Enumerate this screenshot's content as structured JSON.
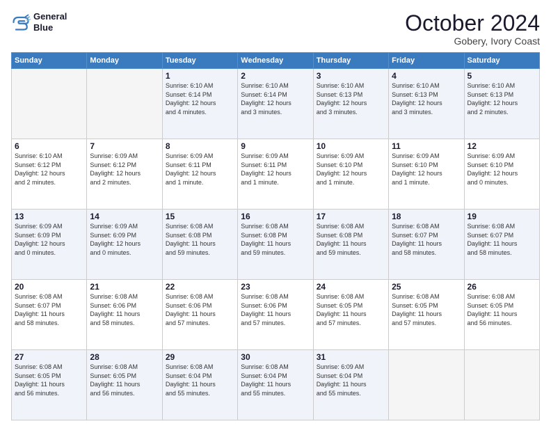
{
  "logo": {
    "line1": "General",
    "line2": "Blue"
  },
  "header": {
    "month": "October 2024",
    "location": "Gobery, Ivory Coast"
  },
  "weekdays": [
    "Sunday",
    "Monday",
    "Tuesday",
    "Wednesday",
    "Thursday",
    "Friday",
    "Saturday"
  ],
  "weeks": [
    [
      {
        "day": null,
        "info": null
      },
      {
        "day": null,
        "info": null
      },
      {
        "day": "1",
        "info": "Sunrise: 6:10 AM\nSunset: 6:14 PM\nDaylight: 12 hours\nand 4 minutes."
      },
      {
        "day": "2",
        "info": "Sunrise: 6:10 AM\nSunset: 6:14 PM\nDaylight: 12 hours\nand 3 minutes."
      },
      {
        "day": "3",
        "info": "Sunrise: 6:10 AM\nSunset: 6:13 PM\nDaylight: 12 hours\nand 3 minutes."
      },
      {
        "day": "4",
        "info": "Sunrise: 6:10 AM\nSunset: 6:13 PM\nDaylight: 12 hours\nand 3 minutes."
      },
      {
        "day": "5",
        "info": "Sunrise: 6:10 AM\nSunset: 6:13 PM\nDaylight: 12 hours\nand 2 minutes."
      }
    ],
    [
      {
        "day": "6",
        "info": "Sunrise: 6:10 AM\nSunset: 6:12 PM\nDaylight: 12 hours\nand 2 minutes."
      },
      {
        "day": "7",
        "info": "Sunrise: 6:09 AM\nSunset: 6:12 PM\nDaylight: 12 hours\nand 2 minutes."
      },
      {
        "day": "8",
        "info": "Sunrise: 6:09 AM\nSunset: 6:11 PM\nDaylight: 12 hours\nand 1 minute."
      },
      {
        "day": "9",
        "info": "Sunrise: 6:09 AM\nSunset: 6:11 PM\nDaylight: 12 hours\nand 1 minute."
      },
      {
        "day": "10",
        "info": "Sunrise: 6:09 AM\nSunset: 6:10 PM\nDaylight: 12 hours\nand 1 minute."
      },
      {
        "day": "11",
        "info": "Sunrise: 6:09 AM\nSunset: 6:10 PM\nDaylight: 12 hours\nand 1 minute."
      },
      {
        "day": "12",
        "info": "Sunrise: 6:09 AM\nSunset: 6:10 PM\nDaylight: 12 hours\nand 0 minutes."
      }
    ],
    [
      {
        "day": "13",
        "info": "Sunrise: 6:09 AM\nSunset: 6:09 PM\nDaylight: 12 hours\nand 0 minutes."
      },
      {
        "day": "14",
        "info": "Sunrise: 6:09 AM\nSunset: 6:09 PM\nDaylight: 12 hours\nand 0 minutes."
      },
      {
        "day": "15",
        "info": "Sunrise: 6:08 AM\nSunset: 6:08 PM\nDaylight: 11 hours\nand 59 minutes."
      },
      {
        "day": "16",
        "info": "Sunrise: 6:08 AM\nSunset: 6:08 PM\nDaylight: 11 hours\nand 59 minutes."
      },
      {
        "day": "17",
        "info": "Sunrise: 6:08 AM\nSunset: 6:08 PM\nDaylight: 11 hours\nand 59 minutes."
      },
      {
        "day": "18",
        "info": "Sunrise: 6:08 AM\nSunset: 6:07 PM\nDaylight: 11 hours\nand 58 minutes."
      },
      {
        "day": "19",
        "info": "Sunrise: 6:08 AM\nSunset: 6:07 PM\nDaylight: 11 hours\nand 58 minutes."
      }
    ],
    [
      {
        "day": "20",
        "info": "Sunrise: 6:08 AM\nSunset: 6:07 PM\nDaylight: 11 hours\nand 58 minutes."
      },
      {
        "day": "21",
        "info": "Sunrise: 6:08 AM\nSunset: 6:06 PM\nDaylight: 11 hours\nand 58 minutes."
      },
      {
        "day": "22",
        "info": "Sunrise: 6:08 AM\nSunset: 6:06 PM\nDaylight: 11 hours\nand 57 minutes."
      },
      {
        "day": "23",
        "info": "Sunrise: 6:08 AM\nSunset: 6:06 PM\nDaylight: 11 hours\nand 57 minutes."
      },
      {
        "day": "24",
        "info": "Sunrise: 6:08 AM\nSunset: 6:05 PM\nDaylight: 11 hours\nand 57 minutes."
      },
      {
        "day": "25",
        "info": "Sunrise: 6:08 AM\nSunset: 6:05 PM\nDaylight: 11 hours\nand 57 minutes."
      },
      {
        "day": "26",
        "info": "Sunrise: 6:08 AM\nSunset: 6:05 PM\nDaylight: 11 hours\nand 56 minutes."
      }
    ],
    [
      {
        "day": "27",
        "info": "Sunrise: 6:08 AM\nSunset: 6:05 PM\nDaylight: 11 hours\nand 56 minutes."
      },
      {
        "day": "28",
        "info": "Sunrise: 6:08 AM\nSunset: 6:05 PM\nDaylight: 11 hours\nand 56 minutes."
      },
      {
        "day": "29",
        "info": "Sunrise: 6:08 AM\nSunset: 6:04 PM\nDaylight: 11 hours\nand 55 minutes."
      },
      {
        "day": "30",
        "info": "Sunrise: 6:08 AM\nSunset: 6:04 PM\nDaylight: 11 hours\nand 55 minutes."
      },
      {
        "day": "31",
        "info": "Sunrise: 6:09 AM\nSunset: 6:04 PM\nDaylight: 11 hours\nand 55 minutes."
      },
      {
        "day": null,
        "info": null
      },
      {
        "day": null,
        "info": null
      }
    ]
  ]
}
